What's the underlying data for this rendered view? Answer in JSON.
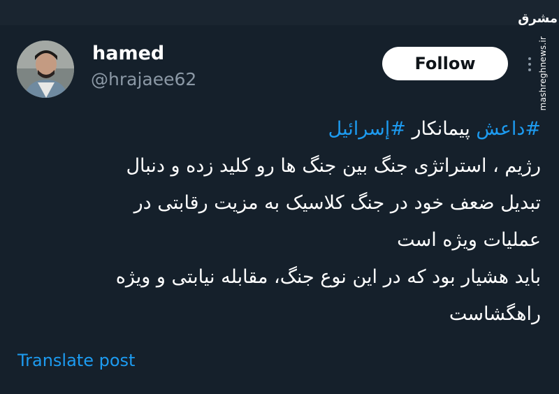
{
  "watermark": {
    "logo_text": "مشرق",
    "url": "mashreghnews.ir"
  },
  "author": {
    "display_name": "hamed",
    "handle": "@hrajaee62",
    "avatar_icon": "user-avatar-photo"
  },
  "follow_button": {
    "label": "Follow"
  },
  "more_menu": {
    "icon": "more-vertical-icon"
  },
  "tweet": {
    "hashtag_1": "#داعش",
    "word_between": "پیمانکار",
    "hashtag_2": "#إسرائیل",
    "line_2": "رژیم ، استراتژی جنگ بین جنگ ها رو کلید زده و دنبال",
    "line_3": "تبدیل ضعف خود در جنگ کلاسیک به مزیت رقابتی در",
    "line_4": "عملیات ویژه است",
    "line_5": "باید هشیار بود که در این نوع جنگ، مقابله نیابتی و ویژه",
    "line_6": "راهگشاست"
  },
  "translate_link": {
    "label": "Translate post"
  },
  "colors": {
    "background": "#15202b",
    "accent": "#1d9bf0",
    "secondary_text": "#8b98a5"
  }
}
